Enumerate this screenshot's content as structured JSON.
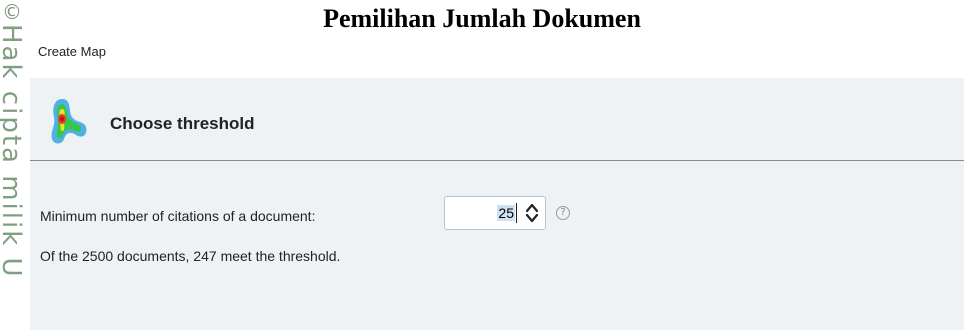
{
  "watermark": {
    "symbol": "©",
    "text": "Hak cipta milik U"
  },
  "document": {
    "title": "Pemilihan Jumlah Dokumen"
  },
  "window": {
    "title": "Create Map"
  },
  "header": {
    "icon": "heatmap-icon",
    "title": "Choose threshold"
  },
  "threshold": {
    "label": "Minimum number of citations of a document:",
    "value": "25",
    "help_icon": "help-icon",
    "help_symbol": "?"
  },
  "result": {
    "text": "Of the 2500 documents, 247 meet the threshold."
  },
  "colors": {
    "header_band": "#eef2f5",
    "selection": "#cfe0f5"
  }
}
